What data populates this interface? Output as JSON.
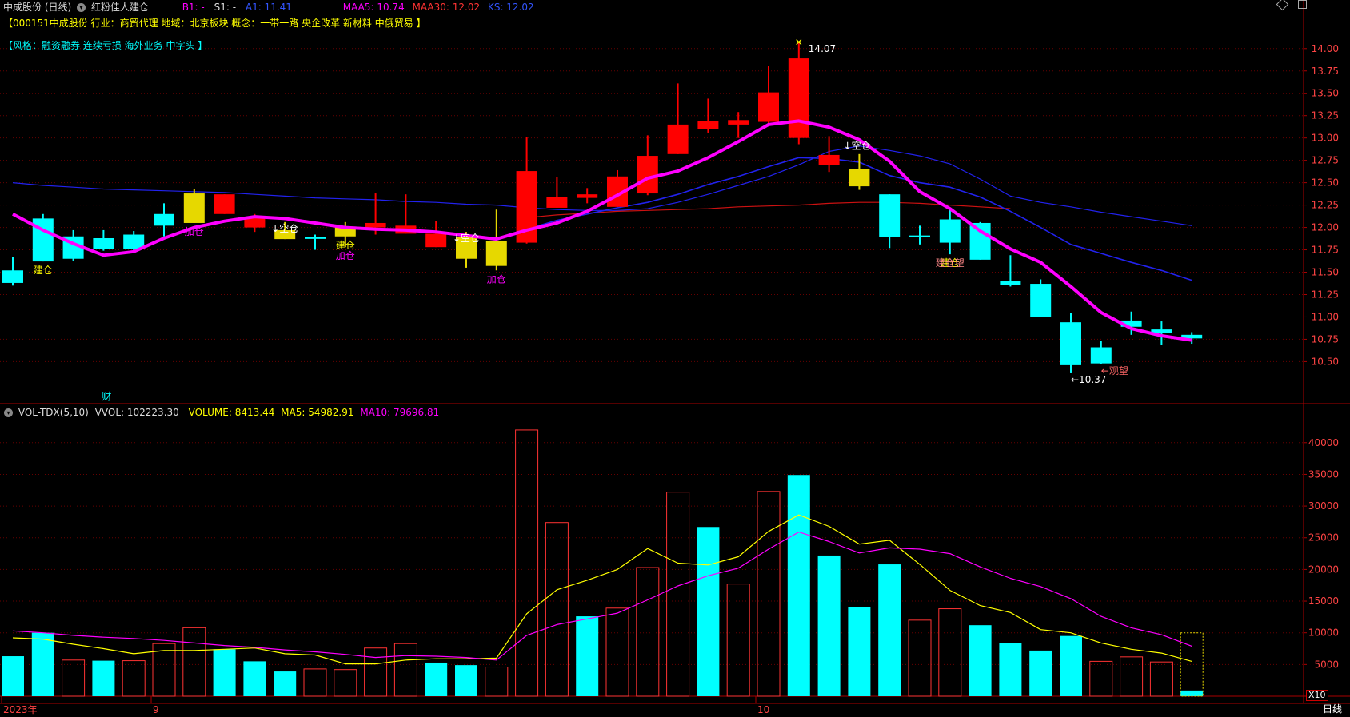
{
  "header": {
    "title": "中成股份 (日线)",
    "indicator_name": "红粉佳人建仓",
    "b1_label": "B1: -",
    "s1_label": "S1: -",
    "a1_label": "A1: 11.41",
    "maa5_label": "MAA5: 10.74",
    "maa30_label": "MAA30: 12.02",
    "ks_label": "KS: 12.02",
    "colors": {
      "b1": "#ff00ff",
      "a1": "#3355ff",
      "maa5": "#ff00ff",
      "maa30": "#ff3333",
      "ks": "#3355ff"
    }
  },
  "stock_info": {
    "line1": "【000151中成股份  行业：商贸代理  地域：北京板块  概念：一带一路  央企改革  新材料  中俄贸易 】",
    "line2": "【风格：融资融券  连续亏损  海外业务  中字头 】",
    "line1_color": "#ffff00",
    "line2_color": "#00ffff"
  },
  "vol_header": {
    "name": "VOL-TDX(5,10)",
    "vvol": "VVOL: 102223.30",
    "volume": "VOLUME: 8413.44",
    "ma5": "MA5: 54982.91",
    "ma10": "MA10: 79696.81"
  },
  "footer": {
    "period": "日线",
    "x_labels": [
      {
        "i": 0,
        "text": "2023年"
      },
      {
        "i": 5,
        "text": "9"
      },
      {
        "i": 25,
        "text": "10"
      }
    ],
    "zoom": "X10",
    "cai_marker": "财"
  },
  "chart_data": [
    {
      "type": "candlestick",
      "name": "price",
      "ylim": [
        10.2,
        14.15
      ],
      "y_ticks": [
        10.5,
        10.75,
        11.0,
        11.25,
        11.5,
        11.75,
        12.0,
        12.25,
        12.5,
        12.75,
        13.0,
        13.25,
        13.5,
        13.75,
        14.0
      ],
      "grid": true,
      "colors": {
        "up": "#ff0000",
        "down": "#00ffff",
        "signal": "#e6d800",
        "ma_main": "#ff00ff",
        "ma_blue": "#2222ee",
        "ma_red": "#cc1111"
      },
      "candles": [
        {
          "o": 11.38,
          "h": 11.67,
          "l": 11.35,
          "c": 11.52,
          "k": "down"
        },
        {
          "o": 12.1,
          "h": 12.15,
          "l": 11.62,
          "c": 11.62,
          "k": "down"
        },
        {
          "o": 11.9,
          "h": 11.97,
          "l": 11.63,
          "c": 11.65,
          "k": "down"
        },
        {
          "o": 11.88,
          "h": 11.97,
          "l": 11.74,
          "c": 11.76,
          "k": "down"
        },
        {
          "o": 11.92,
          "h": 11.96,
          "l": 11.74,
          "c": 11.76,
          "k": "down"
        },
        {
          "o": 12.15,
          "h": 12.27,
          "l": 11.9,
          "c": 12.02,
          "k": "down"
        },
        {
          "o": 12.05,
          "h": 12.43,
          "l": 12.05,
          "c": 12.38,
          "k": "signal"
        },
        {
          "o": 12.37,
          "h": 12.37,
          "l": 12.15,
          "c": 12.15,
          "k": "up"
        },
        {
          "o": 12.12,
          "h": 12.15,
          "l": 11.95,
          "c": 12.0,
          "k": "up"
        },
        {
          "o": 11.87,
          "h": 12.06,
          "l": 11.87,
          "c": 11.97,
          "k": "signal"
        },
        {
          "o": 11.89,
          "h": 11.92,
          "l": 11.75,
          "c": 11.89,
          "k": "down"
        },
        {
          "o": 11.9,
          "h": 12.06,
          "l": 11.78,
          "c": 12.01,
          "k": "signal"
        },
        {
          "o": 12.0,
          "h": 12.38,
          "l": 11.92,
          "c": 12.05,
          "k": "up"
        },
        {
          "o": 11.93,
          "h": 12.37,
          "l": 11.93,
          "c": 12.02,
          "k": "up"
        },
        {
          "o": 11.78,
          "h": 12.07,
          "l": 11.78,
          "c": 11.93,
          "k": "up"
        },
        {
          "o": 11.65,
          "h": 11.95,
          "l": 11.55,
          "c": 11.89,
          "k": "signal"
        },
        {
          "o": 11.57,
          "h": 12.2,
          "l": 11.52,
          "c": 11.85,
          "k": "signal"
        },
        {
          "o": 11.83,
          "h": 13.01,
          "l": 11.82,
          "c": 12.63,
          "k": "up"
        },
        {
          "o": 12.22,
          "h": 12.56,
          "l": 12.22,
          "c": 12.34,
          "k": "up"
        },
        {
          "o": 12.33,
          "h": 12.44,
          "l": 12.27,
          "c": 12.37,
          "k": "up"
        },
        {
          "o": 12.23,
          "h": 12.64,
          "l": 12.23,
          "c": 12.57,
          "k": "up"
        },
        {
          "o": 12.38,
          "h": 13.03,
          "l": 12.36,
          "c": 12.8,
          "k": "up"
        },
        {
          "o": 12.82,
          "h": 13.61,
          "l": 12.82,
          "c": 13.15,
          "k": "up"
        },
        {
          "o": 13.1,
          "h": 13.44,
          "l": 13.06,
          "c": 13.19,
          "k": "up"
        },
        {
          "o": 13.15,
          "h": 13.29,
          "l": 13.0,
          "c": 13.2,
          "k": "up"
        },
        {
          "o": 13.18,
          "h": 13.81,
          "l": 13.16,
          "c": 13.51,
          "k": "up"
        },
        {
          "o": 13.0,
          "h": 14.07,
          "l": 12.93,
          "c": 13.89,
          "k": "up"
        },
        {
          "o": 12.7,
          "h": 13.02,
          "l": 12.62,
          "c": 12.81,
          "k": "up"
        },
        {
          "o": 12.46,
          "h": 12.82,
          "l": 12.42,
          "c": 12.65,
          "k": "signal"
        },
        {
          "o": 12.37,
          "h": 12.37,
          "l": 11.77,
          "c": 11.89,
          "k": "down"
        },
        {
          "o": 11.91,
          "h": 12.02,
          "l": 11.81,
          "c": 11.91,
          "k": "down"
        },
        {
          "o": 12.09,
          "h": 12.2,
          "l": 11.7,
          "c": 11.83,
          "k": "down"
        },
        {
          "o": 12.05,
          "h": 12.06,
          "l": 11.64,
          "c": 11.64,
          "k": "down"
        },
        {
          "o": 11.4,
          "h": 11.69,
          "l": 11.34,
          "c": 11.36,
          "k": "down"
        },
        {
          "o": 11.37,
          "h": 11.42,
          "l": 11.0,
          "c": 11.0,
          "k": "down"
        },
        {
          "o": 10.94,
          "h": 11.04,
          "l": 10.37,
          "c": 10.46,
          "k": "down"
        },
        {
          "o": 10.66,
          "h": 10.73,
          "l": 10.47,
          "c": 10.48,
          "k": "down"
        },
        {
          "o": 10.96,
          "h": 11.06,
          "l": 10.8,
          "c": 10.89,
          "k": "down"
        },
        {
          "o": 10.86,
          "h": 10.95,
          "l": 10.69,
          "c": 10.82,
          "k": "down"
        },
        {
          "o": 10.8,
          "h": 10.83,
          "l": 10.7,
          "c": 10.76,
          "k": "down"
        }
      ],
      "ma_main": [
        12.15,
        11.97,
        11.82,
        11.69,
        11.73,
        11.88,
        12.0,
        12.07,
        12.12,
        12.1,
        12.05,
        12.0,
        11.98,
        11.97,
        11.95,
        11.91,
        11.87,
        11.97,
        12.05,
        12.18,
        12.36,
        12.55,
        12.63,
        12.78,
        12.96,
        13.15,
        13.19,
        13.12,
        12.98,
        12.74,
        12.4,
        12.21,
        11.96,
        11.76,
        11.61,
        11.34,
        11.05,
        10.87,
        10.79,
        10.74
      ],
      "ma_blue_long": [
        12.5,
        12.47,
        12.45,
        12.43,
        12.42,
        12.41,
        12.4,
        12.39,
        12.37,
        12.35,
        12.33,
        12.32,
        12.31,
        12.29,
        12.28,
        12.26,
        12.25,
        12.22,
        12.2,
        12.19,
        12.19,
        12.21,
        12.28,
        12.37,
        12.47,
        12.57,
        12.7,
        12.85,
        12.91,
        12.86,
        12.8,
        12.71,
        12.54,
        12.35,
        12.28,
        12.23,
        12.17,
        12.12,
        12.07,
        12.02
      ],
      "ma_blue_mid": [
        null,
        null,
        null,
        null,
        null,
        null,
        null,
        null,
        null,
        null,
        null,
        null,
        null,
        null,
        null,
        null,
        null,
        11.98,
        12.08,
        12.15,
        12.22,
        12.28,
        12.37,
        12.48,
        12.57,
        12.68,
        12.78,
        12.77,
        12.73,
        12.58,
        12.5,
        12.45,
        12.34,
        12.18,
        12.0,
        11.81,
        11.71,
        11.61,
        11.52,
        11.41
      ],
      "ma_red_long": [
        null,
        null,
        null,
        null,
        null,
        null,
        null,
        null,
        null,
        null,
        null,
        null,
        null,
        null,
        null,
        null,
        null,
        12.11,
        12.14,
        12.16,
        12.18,
        12.19,
        12.2,
        12.21,
        12.23,
        12.24,
        12.25,
        12.27,
        12.28,
        12.28,
        12.27,
        12.25,
        12.23,
        12.21,
        null,
        null,
        null,
        null,
        null,
        null
      ],
      "annotations": [
        {
          "i": 1,
          "dir": "below",
          "text": "建仓",
          "color": "#ffff00"
        },
        {
          "i": 6,
          "dir": "below",
          "text": "加仓",
          "color": "#ff00ff"
        },
        {
          "i": 9,
          "dir": "above",
          "text": "↓空仓",
          "color": "#ffffff"
        },
        {
          "i": 11,
          "dir": "below",
          "text": "加仓",
          "color": "#ff00ff"
        },
        {
          "i": 11,
          "dir": "below2",
          "text": "建仓",
          "color": "#ffff00"
        },
        {
          "i": 15,
          "dir": "above",
          "text": "↓空仓",
          "color": "#ffffff"
        },
        {
          "i": 16,
          "dir": "below",
          "text": "加仓",
          "color": "#ff00ff"
        },
        {
          "i": 26,
          "dir": "max",
          "text": "14.07",
          "color": "#ffffff"
        },
        {
          "i": 27,
          "dir": "right",
          "text": "↓空仓",
          "color": "#ffffff"
        },
        {
          "i": 31,
          "dir": "below",
          "text": "建仓",
          "color": "#ffff00"
        },
        {
          "i": 31,
          "dir": "below3",
          "text": "建仓望",
          "color": "#ff8888"
        },
        {
          "i": 35,
          "dir": "min",
          "text": "←10.37",
          "color": "#ffffff"
        },
        {
          "i": 36,
          "dir": "min",
          "text": "←观望",
          "color": "#ff6666"
        }
      ]
    },
    {
      "type": "bar",
      "name": "volume",
      "ylim": [
        0,
        43000
      ],
      "y_ticks": [
        5000,
        10000,
        15000,
        20000,
        25000,
        30000,
        35000,
        40000
      ],
      "colors": {
        "up": "#ff3333",
        "down": "#00ffff",
        "ma5": "#ffff00",
        "ma10": "#ff00ff"
      },
      "values": [
        6300,
        10000,
        5700,
        5600,
        5600,
        8300,
        10800,
        7400,
        5500,
        3900,
        4300,
        4200,
        7600,
        8300,
        5300,
        4900,
        4600,
        42000,
        27400,
        12600,
        13900,
        20300,
        32200,
        26700,
        17700,
        32300,
        34900,
        22200,
        14100,
        20800,
        12000,
        13800,
        11200,
        8400,
        7200,
        9500,
        5500,
        6200,
        5400,
        900
      ],
      "kinds": [
        "down",
        "down",
        "up",
        "down",
        "up",
        "up",
        "up",
        "down",
        "down",
        "down",
        "up",
        "up",
        "up",
        "up",
        "down",
        "down",
        "up",
        "up",
        "up",
        "down",
        "up",
        "up",
        "up",
        "down",
        "up",
        "up",
        "down",
        "down",
        "down",
        "down",
        "up",
        "up",
        "down",
        "down",
        "down",
        "down",
        "up",
        "up",
        "up",
        "down"
      ],
      "ma5": [
        9200,
        9000,
        8200,
        7500,
        6700,
        7200,
        7200,
        7400,
        7600,
        6700,
        6500,
        5100,
        5100,
        5700,
        5900,
        5900,
        6000,
        13000,
        16800,
        18300,
        20000,
        23300,
        21000,
        20700,
        22000,
        26000,
        28600,
        26800,
        24000,
        24600,
        20800,
        16700,
        14300,
        13200,
        10500,
        10000,
        8400,
        7400,
        6800,
        5500
      ],
      "ma10": [
        10300,
        10000,
        9600,
        9300,
        9100,
        8800,
        8400,
        8000,
        7700,
        7300,
        7000,
        6600,
        6100,
        6400,
        6300,
        6100,
        5700,
        9600,
        11300,
        12200,
        13100,
        15200,
        17400,
        19000,
        20200,
        23200,
        25900,
        24400,
        22600,
        23400,
        23200,
        22500,
        20400,
        18600,
        17300,
        15400,
        12600,
        10800,
        9700,
        7900
      ]
    }
  ]
}
